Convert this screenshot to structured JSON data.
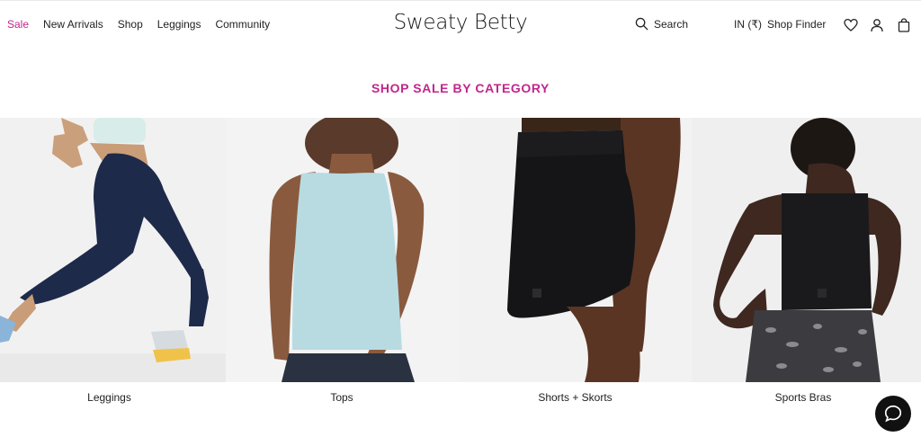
{
  "header": {
    "nav": [
      {
        "label": "Sale"
      },
      {
        "label": "New Arrivals"
      },
      {
        "label": "Shop"
      },
      {
        "label": "Leggings"
      },
      {
        "label": "Community"
      }
    ],
    "logo": "Sweaty Betty",
    "search_label": "Search",
    "locale": "IN (₹)",
    "shop_finder": "Shop Finder",
    "icons": [
      "search-icon",
      "heart-icon",
      "user-icon",
      "bag-icon"
    ]
  },
  "main": {
    "section_title": "SHOP SALE BY CATEGORY",
    "categories": [
      {
        "label": "Leggings"
      },
      {
        "label": "Tops"
      },
      {
        "label": "Shorts + Skorts"
      },
      {
        "label": "Sports Bras"
      }
    ]
  },
  "chat": {
    "icon": "chat-bubble-icon"
  },
  "colors": {
    "accent": "#c2258c",
    "text": "#222222"
  }
}
